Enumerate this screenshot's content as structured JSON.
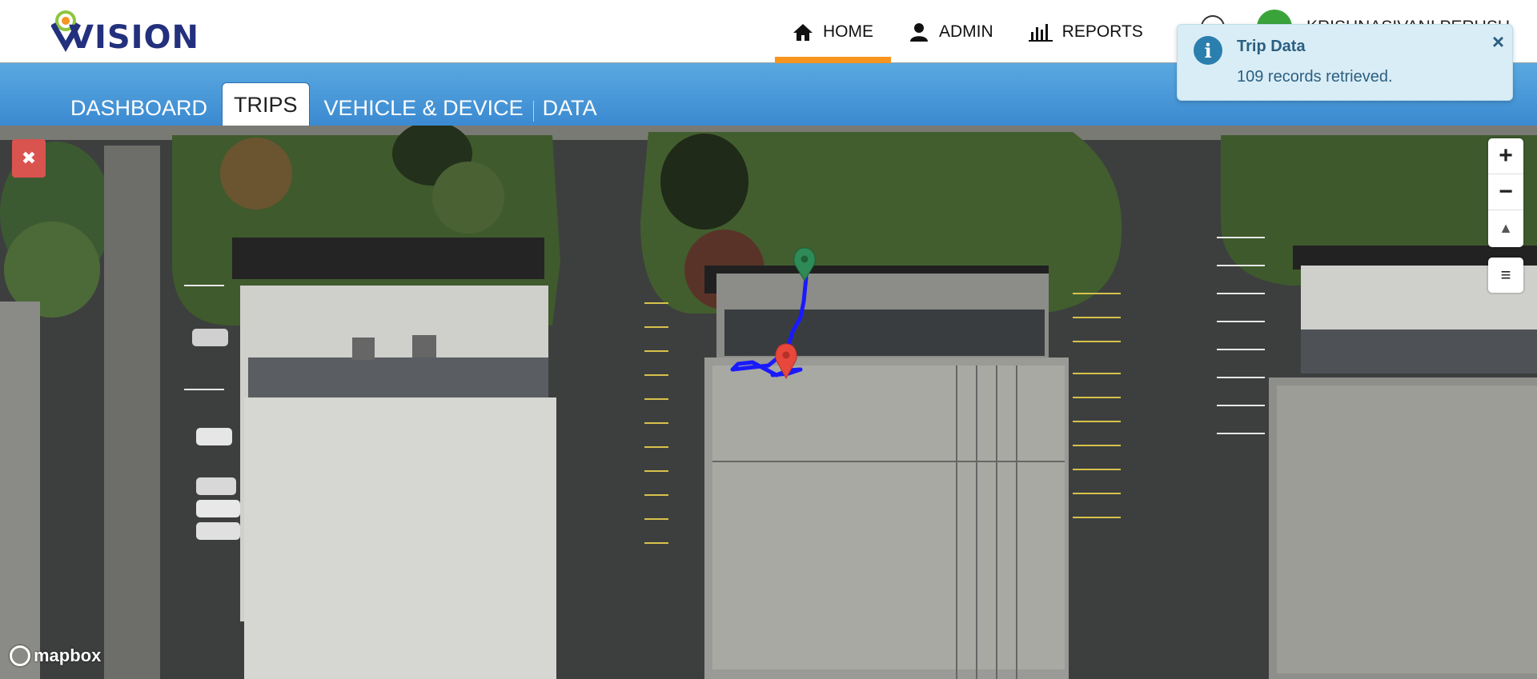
{
  "brand": {
    "name": "VISION"
  },
  "main_nav": [
    {
      "label": "HOME",
      "icon": "home-icon",
      "active": true
    },
    {
      "label": "ADMIN",
      "icon": "user-icon",
      "active": false
    },
    {
      "label": "REPORTS",
      "icon": "bar-chart-icon",
      "active": false
    }
  ],
  "user": {
    "name": "KRISHNASIVANI PERUSU"
  },
  "sub_nav": [
    {
      "label": "DASHBOARD",
      "active": false
    },
    {
      "label": "TRIPS",
      "active": true
    },
    {
      "label": "VEHICLE & DEVICE",
      "active": false
    },
    {
      "label": "DATA",
      "active": false
    }
  ],
  "map": {
    "attribution": "mapbox",
    "zoom_in": "+",
    "zoom_out": "−",
    "compass": "▲",
    "layers": "≡",
    "close": "✖",
    "route_color": "#1a1aff",
    "start_marker_color": "#2e8b57",
    "end_marker_color": "#e8473c"
  },
  "toast": {
    "title": "Trip Data",
    "message": "109 records retrieved.",
    "close": "×"
  }
}
